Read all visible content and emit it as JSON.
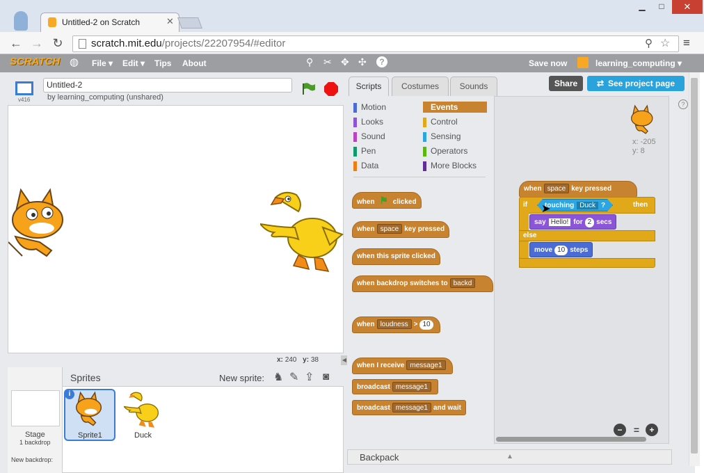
{
  "browser": {
    "tab_title": "Untitled-2 on Scratch",
    "url_host": "scratch.mit.edu",
    "url_path": "/projects/22207954/#editor"
  },
  "menu": {
    "logo": "SCRATCH",
    "file": "File ▾",
    "edit": "Edit ▾",
    "tips": "Tips",
    "about": "About",
    "save_now": "Save now",
    "username": "learning_computing ▾"
  },
  "stage": {
    "project_title": "Untitled-2",
    "byline": "by learning_computing (unshared)",
    "version": "v416",
    "x_label": "x:",
    "x_value": "240",
    "y_label": "y:",
    "y_value": "38"
  },
  "sprites_panel": {
    "header": "Sprites",
    "new_sprite": "New sprite:",
    "stage_label": "Stage",
    "stage_backdrops": "1 backdrop",
    "new_backdrop": "New backdrop:",
    "sprite1": "Sprite1",
    "sprite2": "Duck"
  },
  "tabs": {
    "scripts": "Scripts",
    "costumes": "Costumes",
    "sounds": "Sounds"
  },
  "actions": {
    "share": "Share",
    "see_project": "See project page"
  },
  "categories": [
    {
      "label": "Motion",
      "color": "#4a6cd4"
    },
    {
      "label": "Looks",
      "color": "#8a55d7"
    },
    {
      "label": "Sound",
      "color": "#bb42c3"
    },
    {
      "label": "Pen",
      "color": "#0e9a6c"
    },
    {
      "label": "Data",
      "color": "#ee7d16"
    },
    {
      "label": "Events",
      "color": "#c88330"
    },
    {
      "label": "Control",
      "color": "#e1a91a"
    },
    {
      "label": "Sensing",
      "color": "#2ca5e2"
    },
    {
      "label": "Operators",
      "color": "#5cb712"
    },
    {
      "label": "More Blocks",
      "color": "#632d99"
    }
  ],
  "palette_blocks": {
    "b1_when": "when",
    "b1_clicked": "clicked",
    "b2_when": "when",
    "b2_key": "space",
    "b2_rest": "key pressed",
    "b3": "when this sprite clicked",
    "b4_text": "when backdrop switches to",
    "b4_dd": "backd",
    "b5_when": "when",
    "b5_dd": "loudness",
    "b5_op": ">",
    "b5_num": "10",
    "b6_text": "when I receive",
    "b6_dd": "message1",
    "b7_text": "broadcast",
    "b7_dd": "message1",
    "b8_text": "broadcast",
    "b8_dd": "message1",
    "b8_rest": "and wait"
  },
  "script": {
    "hat_when": "when",
    "hat_key": "space",
    "hat_rest": "key pressed",
    "if_label": "if",
    "touching": "touching",
    "touching_dd": "Duck",
    "q": "?",
    "then": "then",
    "say": "say",
    "say_text": "Hello!",
    "for": "for",
    "secs_num": "2",
    "secs": "secs",
    "else": "else",
    "move": "move",
    "steps_num": "10",
    "steps": "steps"
  },
  "sprite_info": {
    "x": "x: -205",
    "y": "y: 8"
  },
  "backpack": "Backpack"
}
